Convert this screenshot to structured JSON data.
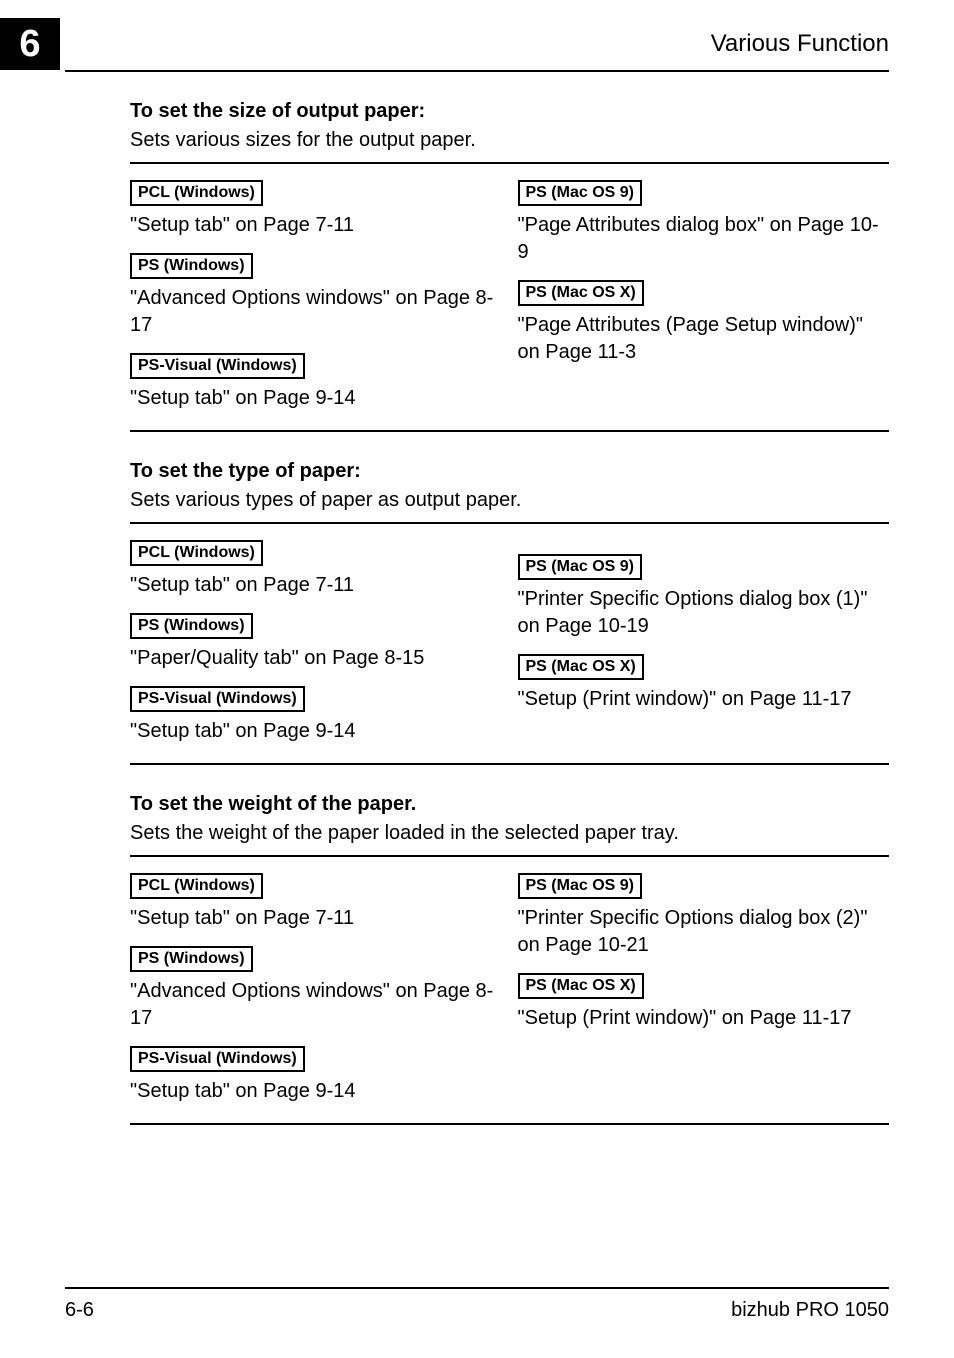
{
  "chapter_number": "6",
  "header_title": "Various Function",
  "pills": {
    "pcl_win": "PCL (Windows)",
    "ps_win": "PS (Windows)",
    "psv_win": "PS-Visual (Windows)",
    "ps_mac9": "PS (Mac OS 9)",
    "ps_macx": "PS (Mac OS X)"
  },
  "sec1": {
    "title": "To set the size of output paper:",
    "desc": "Sets various sizes for the output paper.",
    "pcl": "\"Setup tab\" on Page 7-11",
    "ps": "\"Advanced Options windows\" on Page 8-17",
    "psv": "\"Setup tab\" on Page 9-14",
    "mac9": "\"Page Attributes dialog box\" on Page 10-9",
    "macx": "\"Page Attributes (Page Setup window)\" on Page 11-3"
  },
  "sec2": {
    "title": "To set the type of paper:",
    "desc": "Sets various types of paper as output paper.",
    "pcl": "\"Setup tab\" on Page 7-11",
    "ps": "\"Paper/Quality tab\" on Page 8-15",
    "psv": "\"Setup tab\" on Page 9-14",
    "mac9": "\"Printer Specific Options dialog box (1)\" on Page 10-19",
    "macx": "\"Setup (Print window)\" on Page 11-17"
  },
  "sec3": {
    "title": "To set the weight of the paper.",
    "desc": "Sets the weight of the paper loaded in the selected paper tray.",
    "pcl": "\"Setup tab\" on Page 7-11",
    "ps": "\"Advanced Options windows\" on Page 8-17",
    "psv": "\"Setup tab\" on Page 9-14",
    "mac9": "\"Printer Specific Options dialog box (2)\" on Page 10-21",
    "macx": "\"Setup (Print window)\" on Page 11-17"
  },
  "footer": {
    "page_num": "6-6",
    "product": "bizhub PRO 1050"
  }
}
